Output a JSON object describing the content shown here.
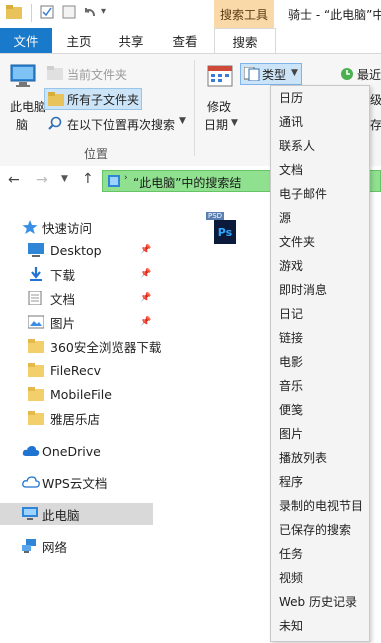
{
  "titlebar": {
    "context_group": "搜索工具",
    "window_title": "骑士 - “此电脑”中"
  },
  "tabs": [
    "文件",
    "主页",
    "共享",
    "查看",
    "搜索"
  ],
  "ribbon": {
    "this_pc": "此电脑",
    "current_folder": "当前文件夹",
    "all_subfolders": "所有子文件夹",
    "search_again": "在以下位置再次搜索",
    "location_group": "位置",
    "modified_date": "修改",
    "modified_date2": "日期",
    "type_button": "类型",
    "recent_label": "最近",
    "advanced_label": "级",
    "save_label": "存"
  },
  "type_menu": [
    "日历",
    "通讯",
    "联系人",
    "文档",
    "电子邮件",
    "源",
    "文件夹",
    "游戏",
    "即时消息",
    "日记",
    "链接",
    "电影",
    "音乐",
    "便笺",
    "图片",
    "播放列表",
    "程序",
    "录制的电视节目",
    "已保存的搜索",
    "任务",
    "视频",
    "Web 历史记录",
    "未知"
  ],
  "address": {
    "breadcrumb": "“此电脑”中的搜索结"
  },
  "nav": {
    "quick_access": "快速访问",
    "items": [
      {
        "label": "Desktop",
        "pinned": true
      },
      {
        "label": "下载",
        "pinned": true
      },
      {
        "label": "文档",
        "pinned": true
      },
      {
        "label": "图片",
        "pinned": true
      },
      {
        "label": "360安全浏览器下载",
        "pinned": false
      },
      {
        "label": "FileRecv",
        "pinned": false
      },
      {
        "label": "MobileFile",
        "pinned": false
      },
      {
        "label": "雅居乐店",
        "pinned": false
      }
    ],
    "onedrive": "OneDrive",
    "wps": "WPS云文档",
    "this_pc": "此电脑",
    "network": "网络"
  },
  "content": {
    "file_badge": "PSD",
    "file_icon_text": "Ps"
  },
  "colors": {
    "accent": "#1979ca",
    "context_tab": "#f9d9a8",
    "breadcrumb_bg": "#8fe08f",
    "selection": "#cce4f7",
    "menu_bg": "#f4f4f4"
  }
}
